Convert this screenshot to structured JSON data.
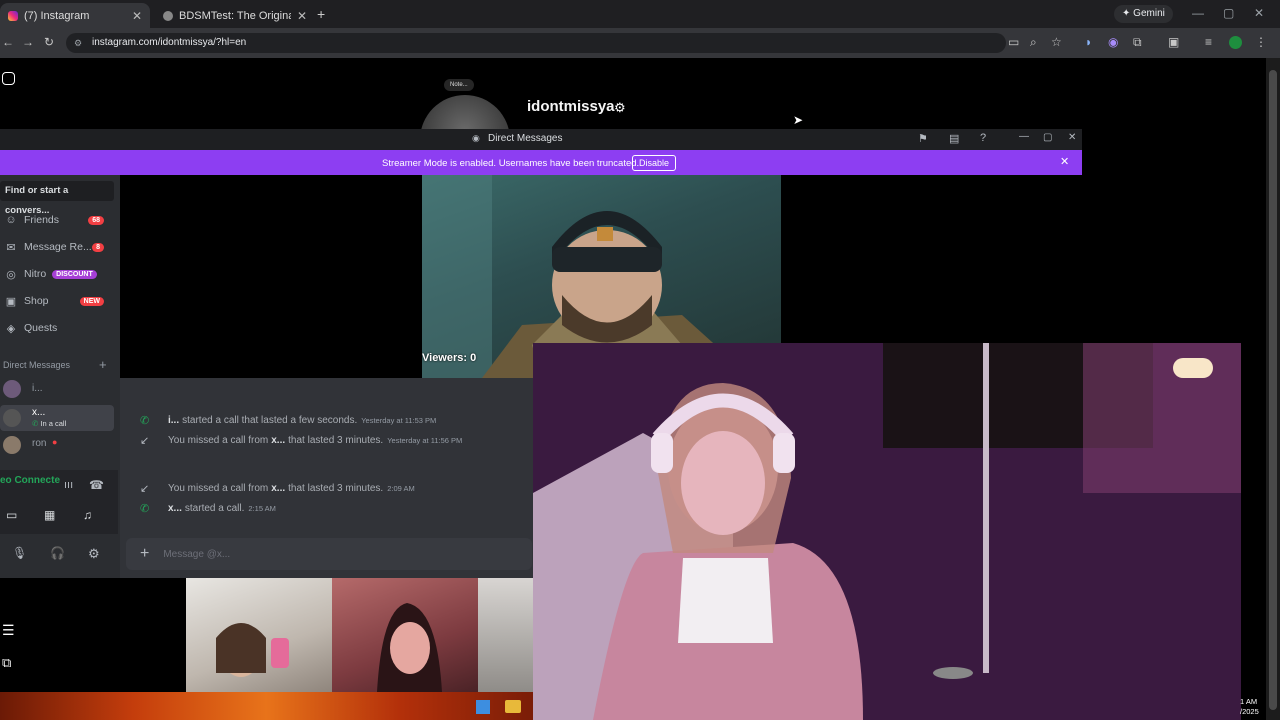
{
  "browser": {
    "tabs": [
      {
        "title": "(7) Instagram",
        "active": true
      },
      {
        "title": "BDSMTest: The Original BDSM ...",
        "active": false
      }
    ],
    "url": "instagram.com/idontmissya/?hl=en",
    "gemini_label": "Gemini"
  },
  "instagram": {
    "username": "idontmissya",
    "note_label": "Note..."
  },
  "discord": {
    "window_title": "Direct Messages",
    "banner_text": "Streamer Mode is enabled. Usernames have been truncated.",
    "banner_button": "Disable",
    "search_placeholder": "Find or start a convers...",
    "nav": [
      {
        "label": "Friends",
        "icon": "friends-icon",
        "badge": "68"
      },
      {
        "label": "Message Re...",
        "icon": "message-requests-icon",
        "badge": "8"
      },
      {
        "label": "Nitro",
        "icon": "nitro-icon",
        "badge": "DISCOUNT"
      },
      {
        "label": "Shop",
        "icon": "shop-icon",
        "badge": "NEW"
      },
      {
        "label": "Quests",
        "icon": "quests-icon",
        "badge": ""
      }
    ],
    "dm_header": "Direct Messages",
    "dms": [
      {
        "name": "i...",
        "status": ""
      },
      {
        "name": "x...",
        "status": "In a call"
      },
      {
        "name": "ron",
        "status": ""
      }
    ],
    "voice_status": "eo Connecte",
    "viewers": "Viewers: 0",
    "messages": [
      {
        "user": "i...",
        "text": "started a call that lasted a few seconds.",
        "time": "Yesterday at 11:53 PM",
        "type": "call"
      },
      {
        "user": "",
        "pre": "You missed a call from",
        "userInline": "x...",
        "text": "that lasted 3 minutes.",
        "time": "Yesterday at 11:56 PM",
        "type": "missed"
      },
      {
        "user": "",
        "pre": "You missed a call from",
        "userInline": "x...",
        "text": "that lasted 3 minutes.",
        "time": "2:09 AM",
        "type": "missed"
      },
      {
        "user": "x...",
        "text": "started a call.",
        "time": "2:15 AM",
        "type": "call"
      }
    ],
    "input_placeholder": "Message @x..."
  },
  "taskbar": {
    "time": "1 AM",
    "date": "/2025"
  },
  "colors": {
    "discord_banner": "#8d3ef2",
    "discord_bg": "#313338",
    "discord_sidebar": "#2b2d31",
    "call_green": "#23a559"
  }
}
